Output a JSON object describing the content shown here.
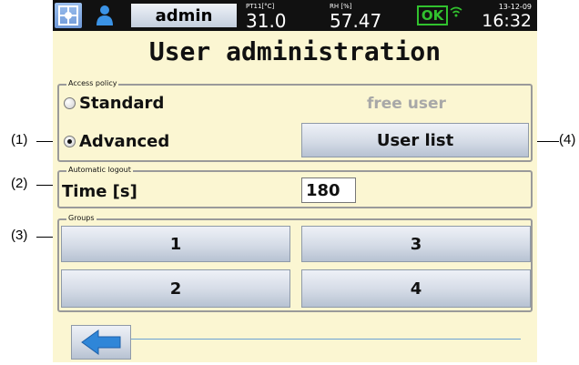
{
  "callouts": [
    "(1)",
    "(2)",
    "(3)",
    "(4)"
  ],
  "statusbar": {
    "user": "admin",
    "pt_label": "PT11[°C]",
    "pt_value": "31.0",
    "rh_label": "RH [%]",
    "rh_value": "57.47",
    "status": "OK",
    "date": "13-12-09",
    "time": "16:32"
  },
  "title": "User administration",
  "access_policy": {
    "label": "Access policy",
    "options": [
      {
        "label": "Standard",
        "checked": false
      },
      {
        "label": "Advanced",
        "checked": true
      }
    ],
    "free_user": "free user",
    "user_list_button": "User list"
  },
  "auto_logout": {
    "label": "Automatic logout",
    "field_label": "Time [s]",
    "value": "180"
  },
  "groups": {
    "label": "Groups",
    "buttons": [
      "1",
      "3",
      "2",
      "4"
    ]
  },
  "icons": {
    "user": "user-icon",
    "back": "back-arrow-icon",
    "wifi": "wifi-icon",
    "logo": "logo-icon"
  },
  "colors": {
    "background": "#fbf6d2",
    "status_ok": "#31c12e",
    "accent_blue": "#2f86d8"
  }
}
